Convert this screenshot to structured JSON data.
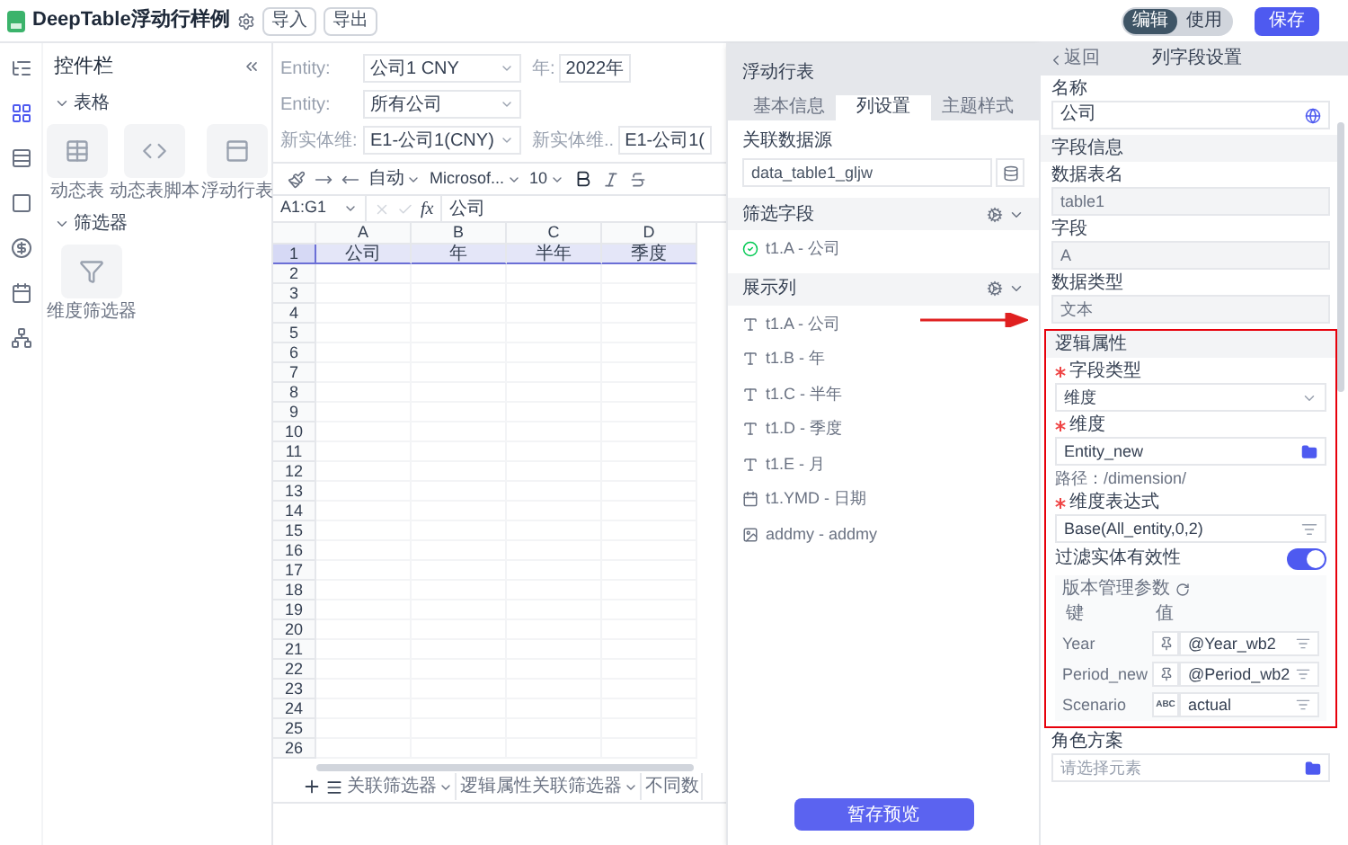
{
  "header": {
    "title": "DeepTable浮动行样例",
    "buttons": [
      "导入",
      "导出"
    ],
    "mode_toggle": [
      {
        "label": "编辑",
        "selected": true
      },
      {
        "label": "使用",
        "selected": false
      }
    ],
    "save": "保存"
  },
  "rail": [
    {
      "selected": false
    },
    {
      "selected": true
    },
    {
      "selected": false
    },
    {
      "selected": false
    },
    {
      "selected": false
    },
    {
      "selected": false
    },
    {
      "selected": false
    }
  ],
  "controls": {
    "title": "控件栏",
    "groups": [
      {
        "label": "表格",
        "expanded": true,
        "items": [
          "动态表",
          "动态表脚本",
          "浮动行表"
        ]
      },
      {
        "label": "筛选器",
        "expanded": true,
        "items": [
          "维度筛选器"
        ]
      }
    ]
  },
  "filters": [
    [
      {
        "label": "Entity:",
        "value": "公司1 CNY"
      },
      {
        "label": "年:",
        "value": "2022年"
      }
    ],
    [
      {
        "label": "Entity:",
        "value": "所有公司"
      }
    ],
    [
      {
        "label": "新实体维:",
        "value": "E1-公司1(CNY)"
      },
      {
        "label": "新实体维..",
        "value": "E1-公司1("
      }
    ]
  ],
  "toolbar": {
    "format": "自动",
    "font": "Microsof...",
    "size": "10"
  },
  "formula_bar": {
    "cell_ref": "A1:G1",
    "fx": "fx",
    "formula": "公司"
  },
  "sheet": {
    "columns": [
      "A",
      "B",
      "C",
      "D"
    ],
    "rows": [
      {
        "number": "1",
        "selected": true,
        "cells": [
          "公司",
          "年",
          "半年",
          "季度"
        ]
      },
      {
        "number": "2",
        "selected": false
      },
      {
        "number": "3",
        "selected": false
      },
      {
        "number": "4",
        "selected": false
      },
      {
        "number": "5",
        "selected": false
      },
      {
        "number": "6",
        "selected": false
      },
      {
        "number": "7",
        "selected": false
      },
      {
        "number": "8",
        "selected": false
      },
      {
        "number": "9",
        "selected": false
      },
      {
        "number": "10",
        "selected": false
      },
      {
        "number": "11",
        "selected": false
      },
      {
        "number": "12",
        "selected": false
      },
      {
        "number": "13",
        "selected": false
      },
      {
        "number": "14",
        "selected": false
      },
      {
        "number": "15",
        "selected": false
      },
      {
        "number": "16",
        "selected": false
      },
      {
        "number": "17",
        "selected": false
      },
      {
        "number": "18",
        "selected": false
      },
      {
        "number": "19",
        "selected": false
      },
      {
        "number": "20",
        "selected": false
      },
      {
        "number": "21",
        "selected": false
      },
      {
        "number": "22",
        "selected": false
      },
      {
        "number": "23",
        "selected": false
      },
      {
        "number": "24",
        "selected": false
      },
      {
        "number": "25",
        "selected": false
      },
      {
        "number": "26",
        "selected": false
      }
    ]
  },
  "sheet_tabs": [
    "关联筛选器",
    "逻辑属性关联筛选器",
    "不同数"
  ],
  "middle_panel": {
    "title": "浮动行表",
    "tabs": [
      {
        "label": "基本信息",
        "selected": false
      },
      {
        "label": "列设置",
        "selected": true
      },
      {
        "label": "主题样式",
        "selected": false
      }
    ],
    "data_source": {
      "label": "关联数据源",
      "value": "data_table1_gljw"
    },
    "filter_fields": {
      "title": "筛选字段",
      "items": [
        "t1.A - 公司"
      ]
    },
    "display_columns": {
      "title": "展示列",
      "items": [
        {
          "label": "t1.A - 公司",
          "kind": "text"
        },
        {
          "label": "t1.B - 年",
          "kind": "text"
        },
        {
          "label": "t1.C - 半年",
          "kind": "text"
        },
        {
          "label": "t1.D - 季度",
          "kind": "text"
        },
        {
          "label": "t1.E - 月",
          "kind": "text"
        },
        {
          "label": "t1.YMD - 日期",
          "kind": "date"
        },
        {
          "label": "addmy - addmy",
          "kind": "image"
        }
      ]
    },
    "button": "暂存预览"
  },
  "right_panel": {
    "back": "返回",
    "title": "列字段设置",
    "name": {
      "label": "名称",
      "value": "公司"
    },
    "section": "字段信息",
    "info_fields": [
      {
        "label": "数据表名",
        "value": "table1",
        "disabled": true
      },
      {
        "label": "字段",
        "value": "A",
        "disabled": true
      },
      {
        "label": "数据类型",
        "value": "文本",
        "disabled": true
      }
    ],
    "logic": {
      "title": "逻辑属性",
      "field_type": {
        "label": "字段类型",
        "value": "维度",
        "required": true
      },
      "dimension": {
        "label": "维度",
        "value": "Entity_new",
        "required": true,
        "path": "路径：/dimension/"
      },
      "expression": {
        "label": "维度表达式",
        "value": "Base(All_entity,0,2)",
        "required": true
      },
      "filter_validity": {
        "label": "过滤实体有效性",
        "on": true
      },
      "version": {
        "title": "版本管理参数",
        "columns": [
          "键",
          "值"
        ],
        "rows": [
          {
            "key": "Year",
            "kind": "variable",
            "value": "@Year_wb2"
          },
          {
            "key": "Period_new",
            "kind": "variable",
            "value": "@Period_wb2"
          },
          {
            "key": "Scenario",
            "kind": "constant",
            "type_label": "ABC",
            "value": "actual"
          }
        ]
      }
    },
    "role": {
      "label": "角色方案",
      "placeholder": "请选择元素"
    }
  }
}
